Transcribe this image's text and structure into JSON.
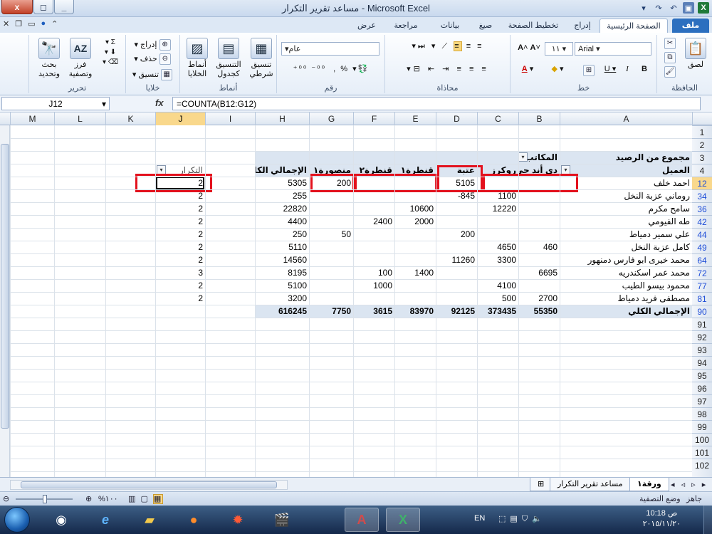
{
  "window": {
    "title": "مساعد تقرير التكرار - Microsoft Excel",
    "close": "x",
    "maximize": "◻",
    "minimize": "_"
  },
  "tabs": [
    "ملف",
    "الصفحة الرئيسية",
    "إدراج",
    "تخطيط الصفحة",
    "صيغ",
    "بيانات",
    "مراجعة",
    "عرض"
  ],
  "ribbon": {
    "clipboard": {
      "label": "الحافظة",
      "paste": "لصق"
    },
    "font": {
      "label": "خط",
      "name": "Arial",
      "size": "١١"
    },
    "alignment": {
      "label": "محاذاة"
    },
    "number": {
      "label": "رقم",
      "format": "عام",
      "percent": "%"
    },
    "styles": {
      "label": "أنماط",
      "conditional": "تنسيق شرطي",
      "table": "التنسيق كجدول",
      "cell": "أنماط الخلايا"
    },
    "cells": {
      "label": "خلايا",
      "insert": "إدراج",
      "delete": "حذف",
      "format": "تنسيق"
    },
    "editing": {
      "label": "تحرير",
      "sort": "فرز وتصفية",
      "find": "بحث وتحديد"
    }
  },
  "formula_bar": {
    "name_box": "J12",
    "fx": "fx",
    "formula": "=COUNTA(B12:G12)"
  },
  "columns": [
    "A",
    "B",
    "C",
    "D",
    "E",
    "F",
    "G",
    "H",
    "I",
    "J",
    "K",
    "L",
    "M"
  ],
  "row_numbers": [
    "1",
    "2",
    "3",
    "4",
    "12",
    "34",
    "36",
    "42",
    "44",
    "49",
    "64",
    "72",
    "77",
    "81",
    "90",
    "91",
    "92",
    "93",
    "94",
    "95",
    "96",
    "97",
    "98",
    "99",
    "100",
    "101",
    "102"
  ],
  "pivot": {
    "title": "مجموع من الرصيد",
    "columns_label": "المكاتب",
    "row_label": "العميل",
    "headers": [
      "دى أند جى",
      "روكرز",
      "عتبة",
      "قنطرة١",
      "قنطرة٢",
      "منصورة١",
      "الإجمالي الكلي"
    ],
    "rows": [
      {
        "name": "احمد خلف",
        "values": [
          "",
          "",
          "5105",
          "",
          "",
          "200",
          "5305"
        ]
      },
      {
        "name": "روماني عزبة النخل",
        "values": [
          "",
          "1100",
          "-845",
          "",
          "",
          "",
          "255"
        ]
      },
      {
        "name": "سامح مكرم",
        "values": [
          "",
          "12220",
          "",
          "10600",
          "",
          "",
          "22820"
        ]
      },
      {
        "name": "طه الفيومي",
        "values": [
          "",
          "",
          "",
          "2000",
          "2400",
          "",
          "4400"
        ]
      },
      {
        "name": "علي سمير دمياط",
        "values": [
          "",
          "",
          "200",
          "",
          "",
          "50",
          "250"
        ]
      },
      {
        "name": "كامل عزبة النخل",
        "values": [
          "460",
          "4650",
          "",
          "",
          "",
          "",
          "5110"
        ]
      },
      {
        "name": "محمد خيرى ابو فارس دمنهور",
        "values": [
          "",
          "3300",
          "11260",
          "",
          "",
          "",
          "14560"
        ]
      },
      {
        "name": "محمد عمر اسكندريه",
        "values": [
          "6695",
          "",
          "",
          "1400",
          "100",
          "",
          "8195"
        ]
      },
      {
        "name": "محمود بيسو الطيب",
        "values": [
          "",
          "4100",
          "",
          "",
          "1000",
          "",
          "5100"
        ]
      },
      {
        "name": "مصطفى فريد دمياط",
        "values": [
          "2700",
          "500",
          "",
          "",
          "",
          "",
          "3200"
        ]
      }
    ],
    "total": {
      "name": "الإجمالي الكلي",
      "values": [
        "55350",
        "373435",
        "92125",
        "83970",
        "3615",
        "7750",
        "616245"
      ]
    }
  },
  "repeat": {
    "header": "التكرار",
    "values": [
      "2",
      "2",
      "2",
      "2",
      "2",
      "2",
      "2",
      "3",
      "2",
      "2"
    ]
  },
  "sheets": [
    "ورقة١",
    "مساعد تقرير التكرار"
  ],
  "status": {
    "ready": "جاهز",
    "mode": "وضع التصفية",
    "zoom": "%١٠٠"
  },
  "taskbar": {
    "lang": "EN",
    "time": "10:18 ص",
    "date": "٢٠١٥/١١/٢٠"
  }
}
